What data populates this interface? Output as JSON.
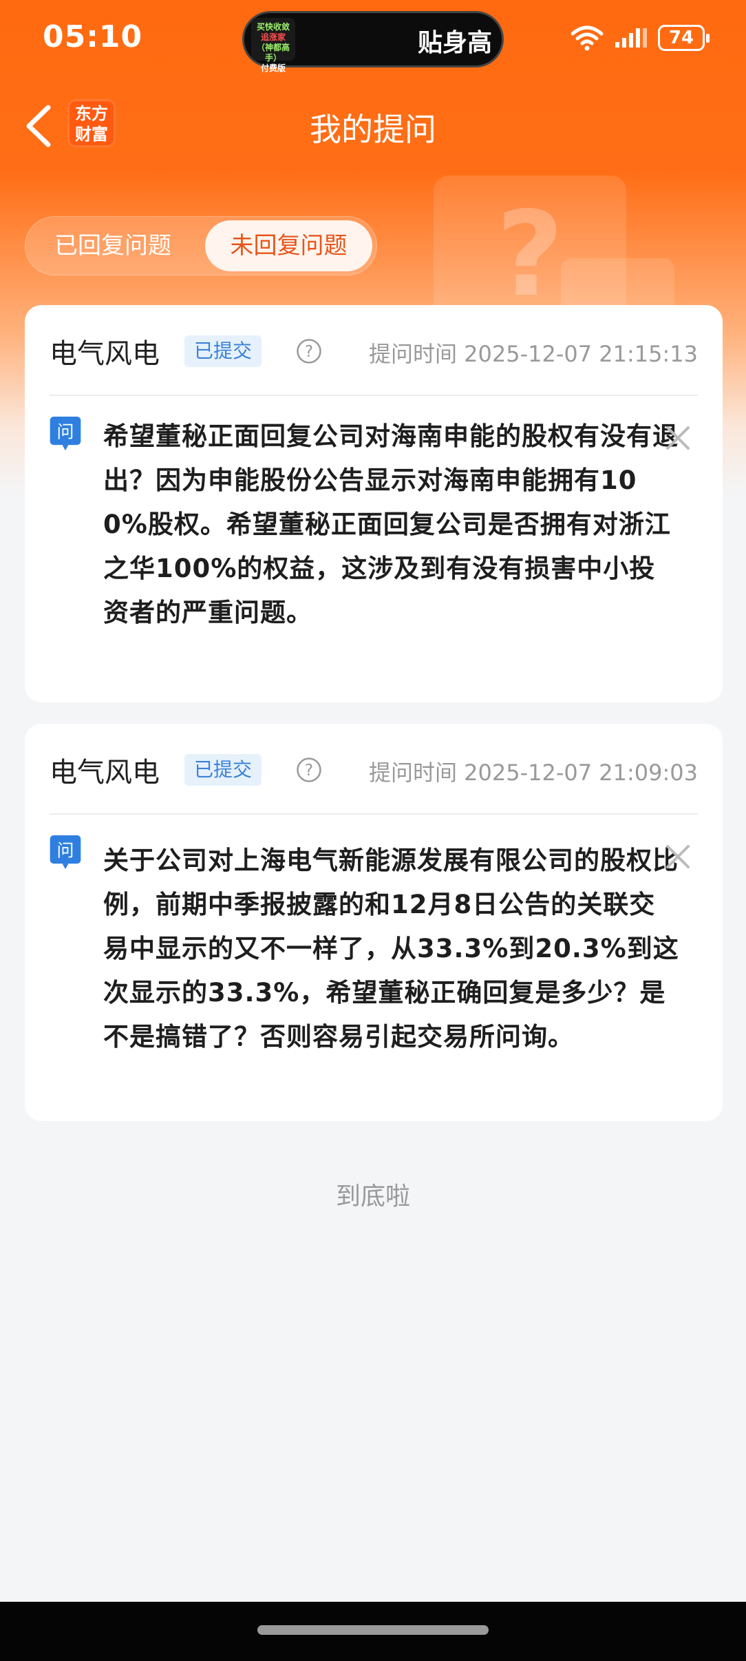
{
  "status_bar": {
    "time": "05:10",
    "island_logo_lines": [
      "买快收敛",
      "追涨家",
      "（神都高手）",
      "付费版"
    ],
    "island_text": "贴身高",
    "battery": "74"
  },
  "header": {
    "logo_line1": "东方",
    "logo_line2": "财富",
    "title": "我的提问"
  },
  "tabs": {
    "replied": "已回复问题",
    "unreplied": "未回复问题",
    "active": "unreplied"
  },
  "questions": [
    {
      "stock": "电气风电",
      "status": "已提交",
      "time_label": "提问时间 2025-12-07 21:15:13",
      "q_label": "问",
      "text": "希望董秘正面回复公司对海南申能的股权有没有退出？因为申能股份公告显示对海南申能拥有100%股权。希望董秘正面回复公司是否拥有对浙江之华100%的权益，这涉及到有没有损害中小投资者的严重问题。"
    },
    {
      "stock": "电气风电",
      "status": "已提交",
      "time_label": "提问时间 2025-12-07 21:09:03",
      "q_label": "问",
      "text": "关于公司对上海电气新能源发展有限公司的股权比例，前期中季报披露的和12月8日公告的关联交易中显示的又不一样了，从33.3%到20.3%到这次显示的33.3%，希望董秘正确回复是多少？是不是搞错了？否则容易引起交易所问询。"
    }
  ],
  "footer": {
    "end_tip": "到底啦"
  },
  "colors": {
    "brand_orange": "#ff6a10",
    "badge_blue": "#3b82d6",
    "active_tab_text": "#e8551a"
  }
}
